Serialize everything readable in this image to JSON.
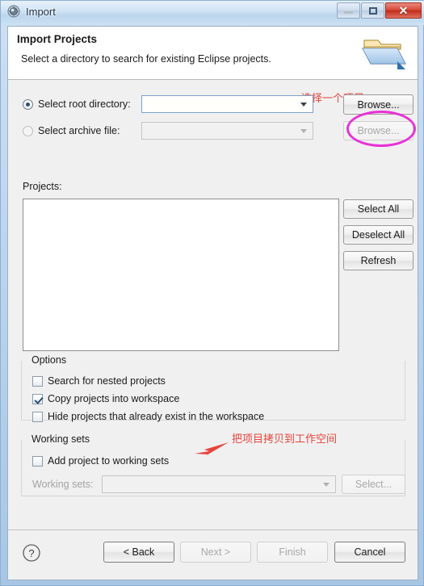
{
  "window": {
    "title": "Import",
    "icon": "eclipse-import-icon",
    "controls": {
      "minimize": "Minimize",
      "maximize": "Maximize",
      "close": "Close"
    }
  },
  "header": {
    "title": "Import Projects",
    "subtitle": "Select a directory to search for existing Eclipse projects.",
    "icon": "open-folder-icon"
  },
  "annotations": {
    "top": "选择一个项目",
    "options": "把项目拷贝到工作空间",
    "highlight_color": "#e832d6",
    "text_color": "#e8443c"
  },
  "source": {
    "root_directory": {
      "label": "Select root directory:",
      "selected": true,
      "value": "",
      "browse_label": "Browse..."
    },
    "archive_file": {
      "label": "Select archive file:",
      "selected": false,
      "value": "",
      "browse_label": "Browse..."
    }
  },
  "projects": {
    "label": "Projects:",
    "items": [],
    "buttons": {
      "select_all": "Select All",
      "deselect_all": "Deselect All",
      "refresh": "Refresh"
    }
  },
  "options": {
    "title": "Options",
    "items": [
      {
        "label": "Search for nested projects",
        "checked": false
      },
      {
        "label": "Copy projects into workspace",
        "checked": true
      },
      {
        "label": "Hide projects that already exist in the workspace",
        "checked": false
      }
    ]
  },
  "working_sets": {
    "title": "Working sets",
    "add_checkbox": {
      "label": "Add project to working sets",
      "checked": false
    },
    "combo_label": "Working sets:",
    "combo_value": "",
    "select_label": "Select..."
  },
  "footer": {
    "help": "?",
    "back": "< Back",
    "next": "Next >",
    "finish": "Finish",
    "cancel": "Cancel"
  }
}
